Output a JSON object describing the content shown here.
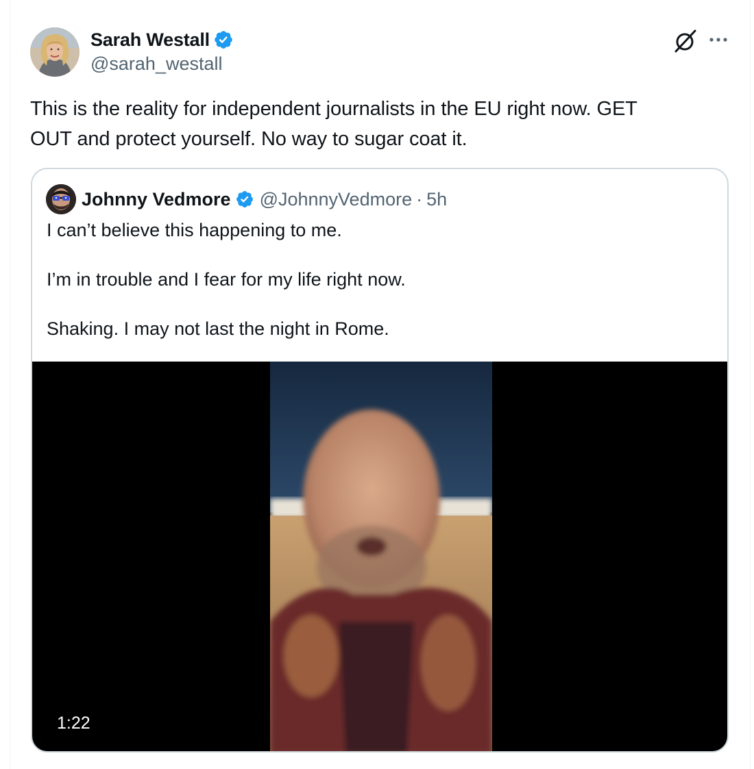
{
  "tweet": {
    "author": {
      "name": "Sarah Westall",
      "handle": "@sarah_westall",
      "verified": true
    },
    "text": [
      "This is the reality for independent journalists in the EU right now. GET",
      "OUT and protect yourself. No way to sugar coat it."
    ],
    "actions": {
      "grok_icon": "grok-icon",
      "more_icon": "more-icon"
    }
  },
  "quote": {
    "author": {
      "name": "Johnny Vedmore",
      "handle": "@JohnnyVedmore",
      "verified": true
    },
    "separator": "·",
    "time": "5h",
    "lines": [
      "I can’t believe this happening to me.",
      "I’m in trouble and I fear for my life right now.",
      "Shaking. I may not last the night in Rome."
    ],
    "media": {
      "type": "video",
      "duration": "1:22"
    }
  },
  "colors": {
    "text_primary": "#0f1419",
    "text_secondary": "#536471",
    "verified_blue": "#1d9bf0",
    "border": "#cfd9de"
  }
}
